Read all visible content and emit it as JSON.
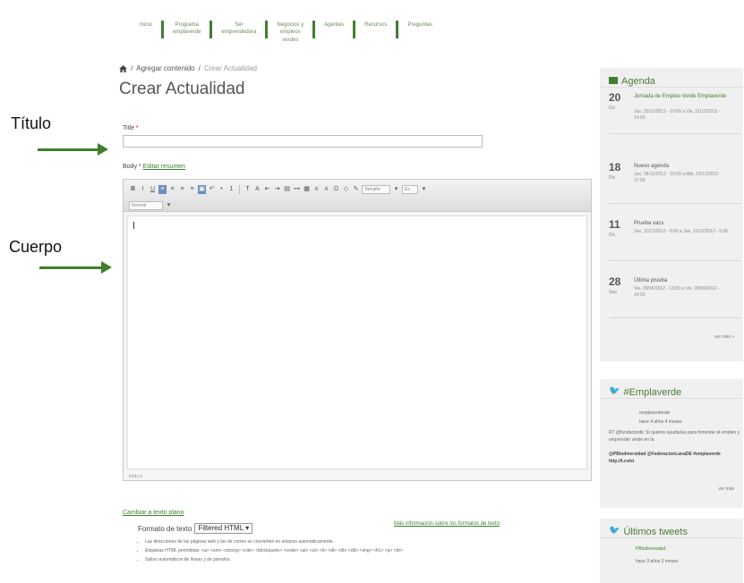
{
  "nav": {
    "items": [
      "Inicio",
      "Programa\nemplaverde",
      "Ser\nemprendedora",
      "Negocios y\nempleos\nverdes",
      "Agentes",
      "Recursos",
      "Preguntas"
    ]
  },
  "breadcrumb": {
    "parent": "Agregar contenido",
    "current": "Crear Actualidad"
  },
  "page_title": "Crear Actualidad",
  "annotations": {
    "title_label": "Título",
    "body_label": "Cuerpo"
  },
  "form": {
    "title_label": "Title",
    "title_required": "*",
    "title_value": "",
    "body_label": "Body",
    "body_required": "*",
    "edit_summary_link": "Editar resumen",
    "editor_status": "body p",
    "font_select": "Tamaño",
    "size_select": "Es",
    "format_select_small": "Normal",
    "toggle_link": "Cambiar a texto plano",
    "text_format_label": "Formato de texto",
    "text_format_value": "Filtered HTML",
    "format_help_link": "Más información sobre los formatos de texto",
    "tips": [
      "Las direcciones de las páginas web y las de correo se convierten en enlaces automáticamente.",
      "Etiquetas HTML permitidas: <a> <em> <strong> <cite> <blockquote> <code> <ul> <ol> <li> <dl> <dt> <dd> <img> <h1> <p> <br>",
      "Saltos automáticos de líneas y de párrafos."
    ]
  },
  "agenda": {
    "title": "Agenda",
    "events": [
      {
        "day": "20",
        "month": "Dic",
        "title": "Jornada de Empleo Verde Emplaverde",
        "time": "Jue, 20/12/2012 - 10:00 a Vie, 21/12/2012 - 14:00",
        "link": true
      },
      {
        "day": "18",
        "month": "Dic",
        "title": "Nuevo agenda",
        "time": "Jue, 18/12/2012 - 15:00 a Mié, 19/12/2012 - 17:00",
        "link": false
      },
      {
        "day": "11",
        "month": "Dic",
        "title": "Prueba vacs",
        "time": "Jue, 11/12/2012 - 9:00 a Jue, 11/12/2012 - 9:30",
        "link": false
      },
      {
        "day": "28",
        "month": "Sep",
        "title": "Última prueba",
        "time": "Vie, 28/09/2012 - 13:00 a Vie, 28/09/2012 - 14:00",
        "link": false
      }
    ],
    "more": "ver más »"
  },
  "twitter": {
    "title": "#Emplaverde",
    "user": "emplaverdende",
    "ago": "hace 4 años 4 meses",
    "text": "RT @fundacionbi: Si quieres ayudarlas para fomentar el empleo y emprender verde en la",
    "mentions": "@PBiodiversidad @FederacionLanaDE #emplaverde http://t.co/ei",
    "more": "ver más"
  },
  "latest_tweets": {
    "title": "Últimos tweets",
    "user": "PBiodiversidad",
    "ago": "hace 3 años 3 meses"
  }
}
